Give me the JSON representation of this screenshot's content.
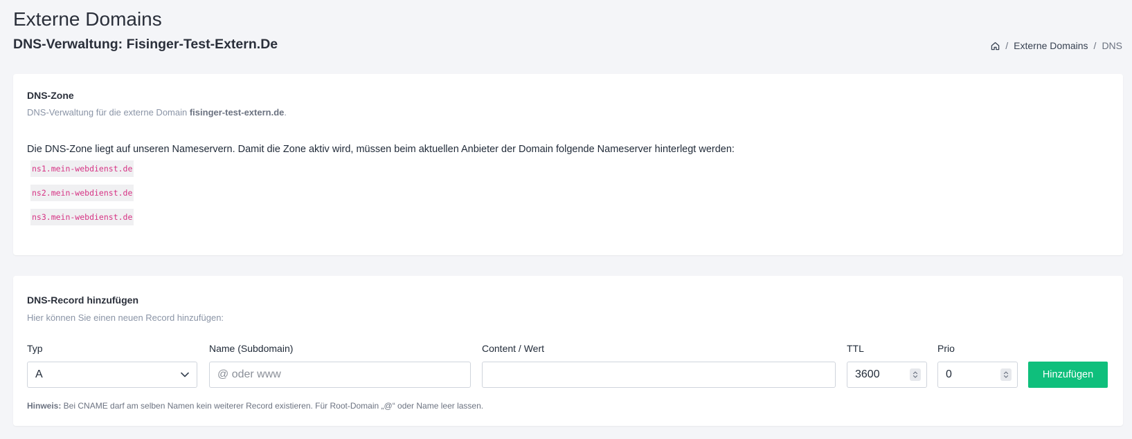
{
  "header": {
    "title": "Externe Domains",
    "subtitle": "DNS-Verwaltung: Fisinger-Test-Extern.De"
  },
  "breadcrumb": {
    "home_icon": "home-icon",
    "items": [
      "Externe Domains"
    ],
    "current": "DNS"
  },
  "dns_zone": {
    "title": "DNS-Zone",
    "description_prefix": "DNS-Verwaltung für die externe Domain ",
    "domain": "fisinger-test-extern.de",
    "description_suffix": ".",
    "info_text": "Die DNS-Zone liegt auf unseren Nameservern. Damit die Zone aktiv wird, müssen beim aktuellen Anbieter der Domain folgende Nameserver hinterlegt werden:",
    "nameservers": [
      "ns1.mein-webdienst.de",
      "ns2.mein-webdienst.de",
      "ns3.mein-webdienst.de"
    ]
  },
  "add_record": {
    "title": "DNS-Record hinzufügen",
    "description": "Hier können Sie einen neuen Record hinzufügen:",
    "fields": {
      "type": {
        "label": "Typ",
        "value": "A"
      },
      "name": {
        "label": "Name (Subdomain)",
        "placeholder": "@ oder www",
        "value": ""
      },
      "content": {
        "label": "Content / Wert",
        "value": ""
      },
      "ttl": {
        "label": "TTL",
        "value": "3600"
      },
      "prio": {
        "label": "Prio",
        "value": "0"
      }
    },
    "submit_label": "Hinzufügen",
    "hint_label": "Hinweis:",
    "hint_text": " Bei CNAME darf am selben Namen kein weiterer Record existieren. Für Root-Domain „@“ oder Name leer lassen."
  },
  "colors": {
    "accent": "#0fbf7c",
    "code": "#d63384",
    "background": "#f4f5f8"
  }
}
